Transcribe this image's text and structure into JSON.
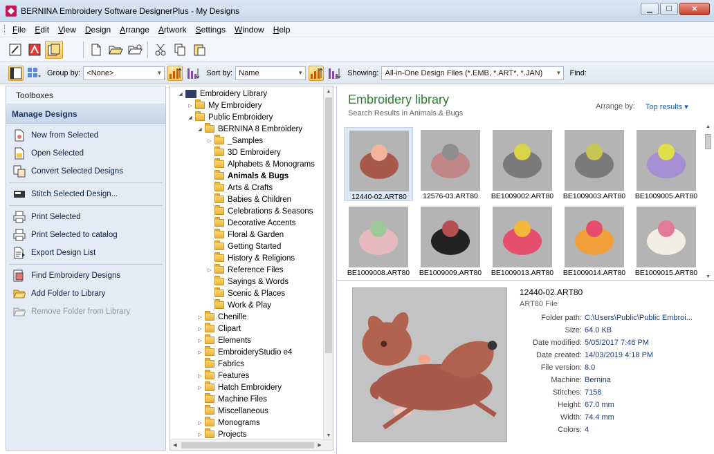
{
  "window": {
    "title": "BERNINA Embroidery Software DesignerPlus - My Designs"
  },
  "menu": [
    "File",
    "Edit",
    "View",
    "Design",
    "Arrange",
    "Artwork",
    "Settings",
    "Window",
    "Help"
  ],
  "toolbar2": {
    "group_label": "Group by:",
    "group_value": "<None>",
    "sort_label": "Sort by:",
    "sort_value": "Name",
    "showing_label": "Showing:",
    "showing_value": "All-in-One Design Files (*.EMB, *.ART*, *.JAN)",
    "find_label": "Find:"
  },
  "toolboxes": {
    "header": "Toolboxes",
    "section": "Manage Designs",
    "items": [
      {
        "label": "New from Selected",
        "icon": "new-design-icon"
      },
      {
        "label": "Open Selected",
        "icon": "open-design-icon"
      },
      {
        "label": "Convert Selected Designs",
        "icon": "convert-icon"
      },
      {
        "label": "Stitch Selected Design...",
        "icon": "stitch-machine-icon"
      },
      {
        "label": "Print Selected",
        "icon": "print-icon"
      },
      {
        "label": "Print Selected to catalog",
        "icon": "print-catalog-icon"
      },
      {
        "label": "Export Design List",
        "icon": "export-list-icon"
      },
      {
        "label": "Find Embroidery Designs",
        "icon": "find-designs-icon"
      },
      {
        "label": "Add Folder to Library",
        "icon": "add-folder-icon"
      },
      {
        "label": "Remove Folder from Library",
        "icon": "remove-folder-icon"
      }
    ]
  },
  "tree": [
    {
      "label": "Embroidery Library",
      "level": 0,
      "expanded": true,
      "root": true
    },
    {
      "label": "My Embroidery",
      "level": 1,
      "expanded": false
    },
    {
      "label": "Public Embroidery",
      "level": 1,
      "expanded": true
    },
    {
      "label": "BERNINA 8 Embroidery",
      "level": 2,
      "expanded": true
    },
    {
      "label": "_Samples",
      "level": 3,
      "expanded": false
    },
    {
      "label": "3D Embroidery",
      "level": 3
    },
    {
      "label": "Alphabets & Monograms",
      "level": 3
    },
    {
      "label": "Animals & Bugs",
      "level": 3,
      "selected": true
    },
    {
      "label": "Arts & Crafts",
      "level": 3
    },
    {
      "label": "Babies & Children",
      "level": 3
    },
    {
      "label": "Celebrations & Seasons",
      "level": 3
    },
    {
      "label": "Decorative Accents",
      "level": 3
    },
    {
      "label": "Floral & Garden",
      "level": 3
    },
    {
      "label": "Getting Started",
      "level": 3
    },
    {
      "label": "History & Religions",
      "level": 3
    },
    {
      "label": "Reference Files",
      "level": 3,
      "expanded": false
    },
    {
      "label": "Sayings & Words",
      "level": 3
    },
    {
      "label": "Scenic & Places",
      "level": 3
    },
    {
      "label": "Work & Play",
      "level": 3
    },
    {
      "label": "Chenille",
      "level": 2,
      "expanded": false
    },
    {
      "label": "Clipart",
      "level": 2,
      "expanded": false
    },
    {
      "label": "Elements",
      "level": 2,
      "expanded": false
    },
    {
      "label": "EmbroideryStudio e4",
      "level": 2,
      "expanded": false
    },
    {
      "label": "Fabrics",
      "level": 2
    },
    {
      "label": "Features",
      "level": 2,
      "expanded": false
    },
    {
      "label": "Hatch Embroidery",
      "level": 2,
      "expanded": false
    },
    {
      "label": "Machine Files",
      "level": 2
    },
    {
      "label": "Miscellaneous",
      "level": 2
    },
    {
      "label": "Monograms",
      "level": 2,
      "expanded": false
    },
    {
      "label": "Projects",
      "level": 2,
      "expanded": false
    }
  ],
  "library": {
    "title": "Embroidery library",
    "subtitle": "Search Results in Animals & Bugs",
    "arrange_label": "Arrange by:",
    "arrange_value": "Top results",
    "thumbnails": [
      "12440-02.ART80",
      "12576-03.ART80",
      "BE1009002.ART80",
      "BE1009003.ART80",
      "BE1009005.ART80",
      "BE1009008.ART80",
      "BE1009009.ART80",
      "BE1009013.ART80",
      "BE1009014.ART80",
      "BE1009015.ART80"
    ]
  },
  "details": {
    "name": "12440-02.ART80",
    "type": "ART80 File",
    "props": [
      {
        "k": "Folder path:",
        "v": "C:\\Users\\Public\\Public Embroi..."
      },
      {
        "k": "Size:",
        "v": "64.0 KB"
      },
      {
        "k": "Date modified:",
        "v": "5/05/2017 7:46 PM"
      },
      {
        "k": "Date created:",
        "v": "14/03/2019 4:18 PM"
      },
      {
        "k": "File version:",
        "v": "8.0"
      },
      {
        "k": "Machine:",
        "v": "Bernina"
      },
      {
        "k": "Stitches:",
        "v": "7158"
      },
      {
        "k": "Height:",
        "v": "67.0 mm"
      },
      {
        "k": "Width:",
        "v": "74.4 mm"
      },
      {
        "k": "Colors:",
        "v": "4"
      }
    ]
  }
}
